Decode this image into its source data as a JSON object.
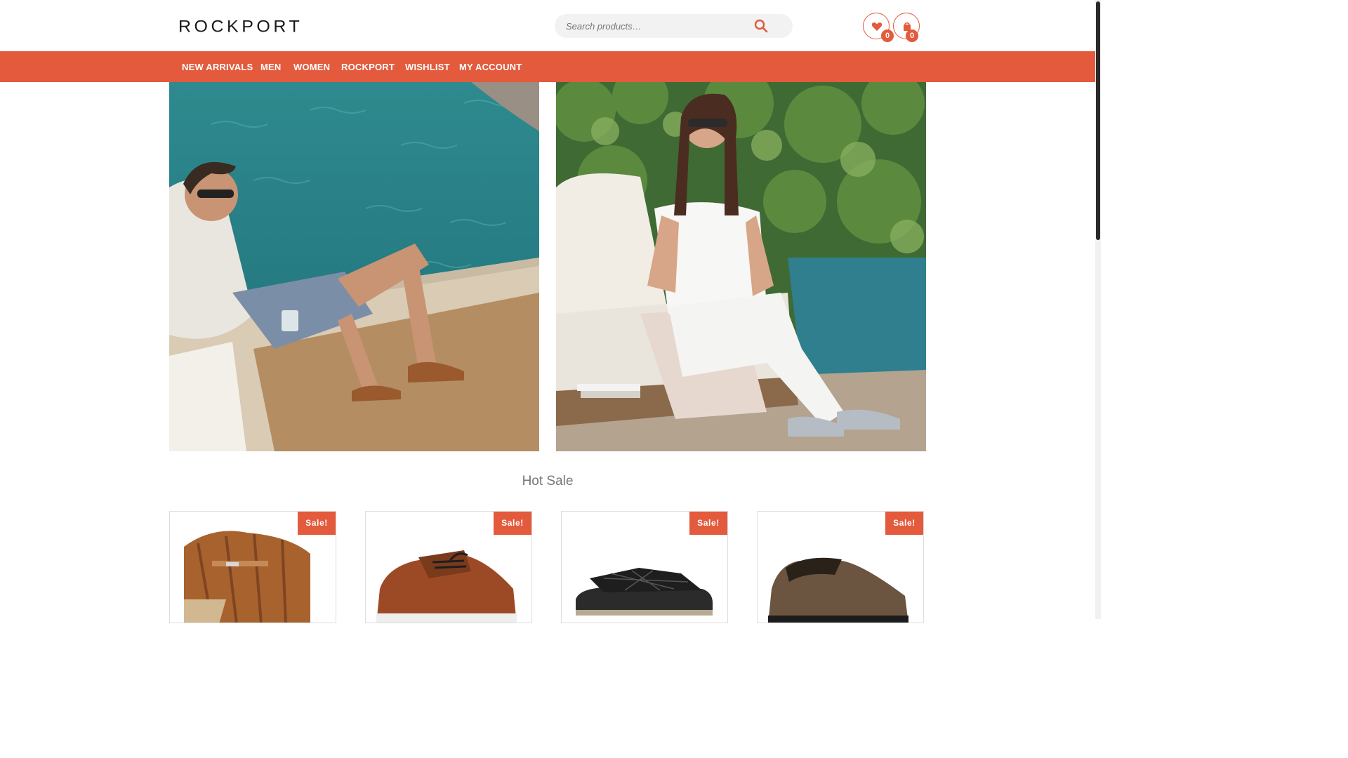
{
  "brand": {
    "logo_text": "ROCKPORT"
  },
  "search": {
    "placeholder": "Search products…"
  },
  "header": {
    "wishlist_count": "0",
    "cart_count": "0"
  },
  "nav": {
    "items": [
      {
        "label": "NEW ARRIVALS"
      },
      {
        "label": "MEN"
      },
      {
        "label": "WOMEN"
      },
      {
        "label": "ROCKPORT"
      },
      {
        "label": "WISHLIST"
      },
      {
        "label": "MY ACCOUNT"
      }
    ]
  },
  "icons": {
    "search": "search-icon",
    "wishlist": "heart-icon",
    "cart": "shopping-bag-icon"
  },
  "colors": {
    "accent": "#e35a3d",
    "text": "#333333",
    "muted": "#777777"
  },
  "hot_sale": {
    "title": "Hot Sale",
    "products": [
      {
        "badge": "Sale!"
      },
      {
        "badge": "Sale!"
      },
      {
        "badge": "Sale!"
      },
      {
        "badge": "Sale!"
      }
    ]
  }
}
